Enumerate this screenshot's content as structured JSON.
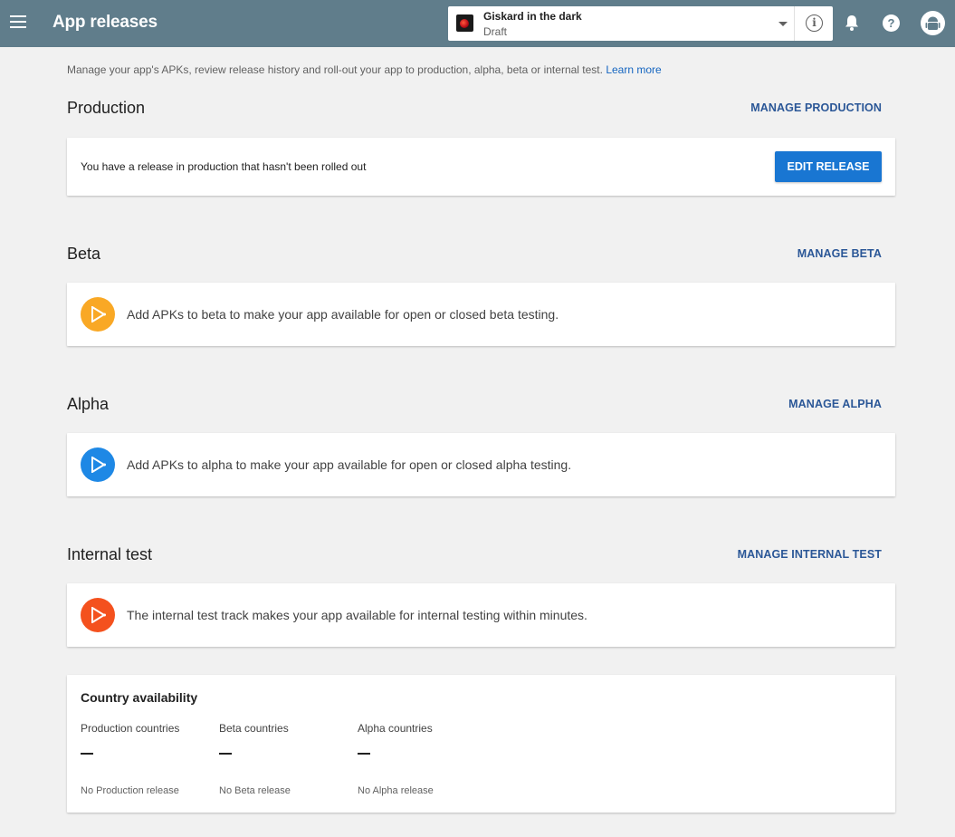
{
  "header": {
    "title": "App releases",
    "app": {
      "name": "Giskard in the dark",
      "status": "Draft"
    },
    "help_glyph": "?",
    "info_glyph": "i"
  },
  "intro": {
    "text": "Manage your app's APKs, review release history and roll-out your app to production, alpha, beta or internal test.",
    "link": "Learn more"
  },
  "production": {
    "title": "Production",
    "manage_label": "MANAGE PRODUCTION",
    "message": "You have a release in production that hasn't been rolled out",
    "edit_label": "EDIT RELEASE"
  },
  "tracks": [
    {
      "title": "Beta",
      "manage_label": "MANAGE BETA",
      "message": "Add APKs to beta to make your app available for open or closed beta testing.",
      "color": "#f9a825"
    },
    {
      "title": "Alpha",
      "manage_label": "MANAGE ALPHA",
      "message": "Add APKs to alpha to make your app available for open or closed alpha testing.",
      "color": "#1e88e5"
    },
    {
      "title": "Internal test",
      "manage_label": "MANAGE INTERNAL TEST",
      "message": "The internal test track makes your app available for internal testing within minutes.",
      "color": "#f4511e"
    }
  ],
  "country_availability": {
    "title": "Country availability",
    "columns": [
      {
        "label": "Production countries",
        "value": "--",
        "note": "No Production release"
      },
      {
        "label": "Beta countries",
        "value": "--",
        "note": "No Beta release"
      },
      {
        "label": "Alpha countries",
        "value": "--",
        "note": "No Alpha release"
      }
    ]
  },
  "colors": {
    "header_bg": "#607d8b",
    "page_bg": "#f1f1f1",
    "primary_button": "#1976d2",
    "link": "#2b5797"
  }
}
